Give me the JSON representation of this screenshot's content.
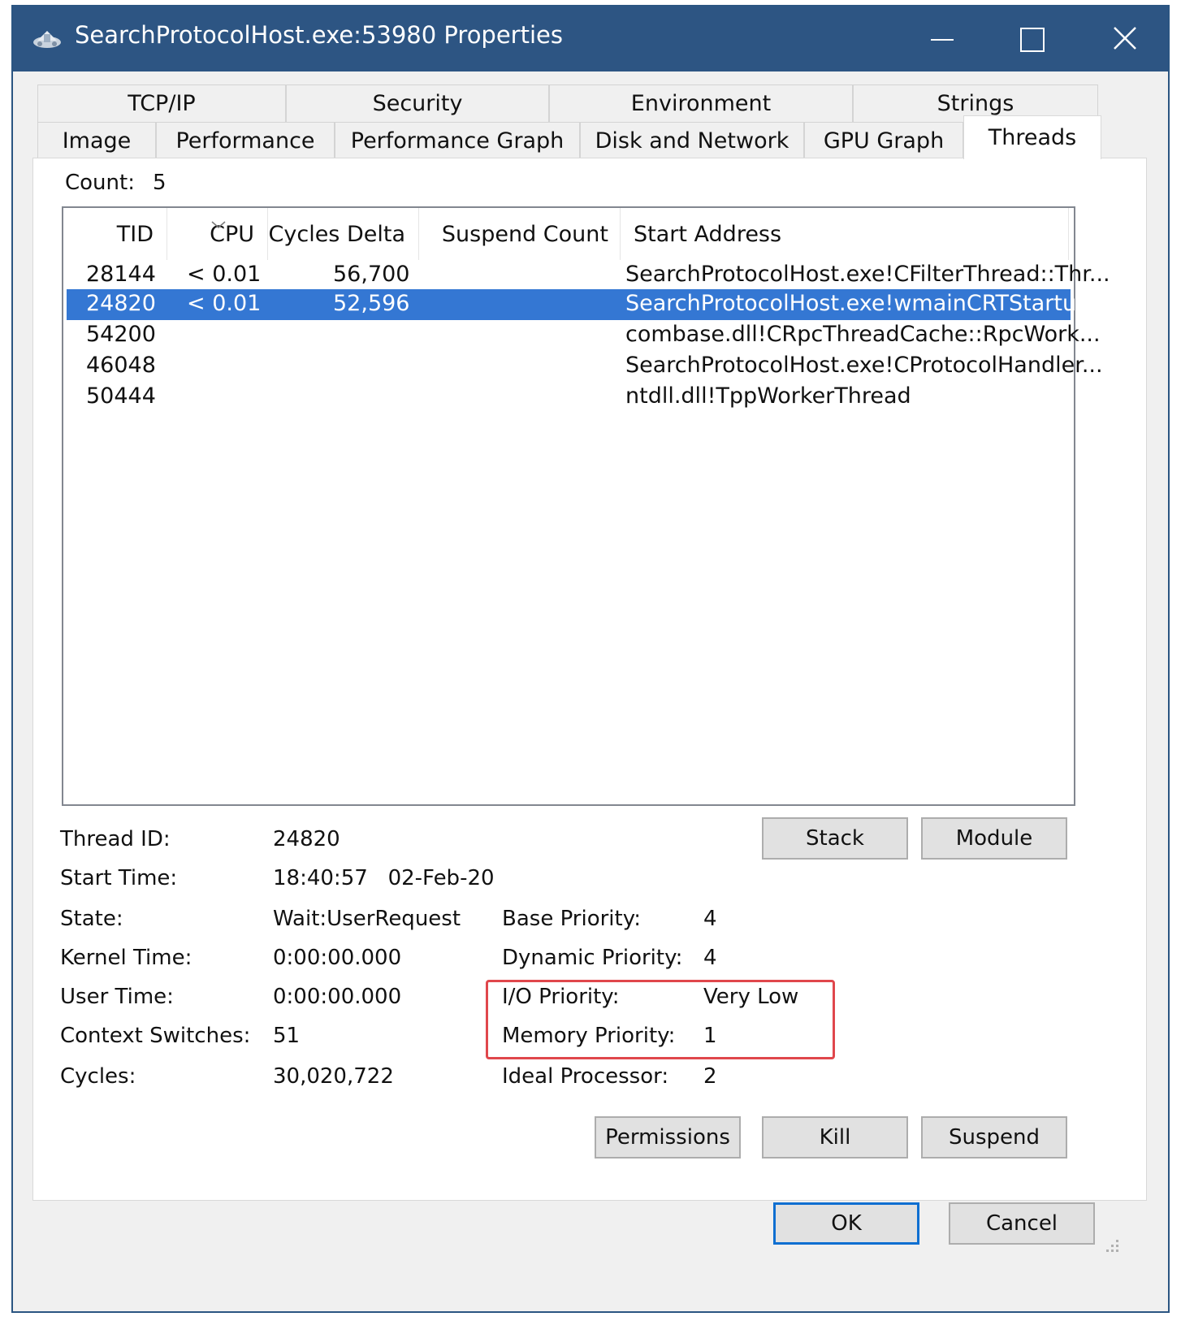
{
  "window": {
    "title": "SearchProtocolHost.exe:53980 Properties"
  },
  "tabs": {
    "row1": [
      {
        "label": "TCP/IP"
      },
      {
        "label": "Security"
      },
      {
        "label": "Environment"
      },
      {
        "label": "Strings"
      }
    ],
    "row2": [
      {
        "label": "Image"
      },
      {
        "label": "Performance"
      },
      {
        "label": "Performance Graph"
      },
      {
        "label": "Disk and Network"
      },
      {
        "label": "GPU Graph"
      },
      {
        "label": "Threads",
        "active": true
      }
    ]
  },
  "threads": {
    "count_label": "Count:",
    "count_value": "5",
    "columns": [
      "TID",
      "CPU",
      "Cycles Delta",
      "Suspend Count",
      "Start Address"
    ],
    "sorted_column": "CPU",
    "rows": [
      {
        "tid": "28144",
        "cpu": "< 0.01",
        "cycles_delta": "56,700",
        "suspend_count": "",
        "start_address": "SearchProtocolHost.exe!CFilterThread::Thr..."
      },
      {
        "tid": "24820",
        "cpu": "< 0.01",
        "cycles_delta": "52,596",
        "suspend_count": "",
        "start_address": "SearchProtocolHost.exe!wmainCRTStartup",
        "selected": true
      },
      {
        "tid": "54200",
        "cpu": "",
        "cycles_delta": "",
        "suspend_count": "",
        "start_address": "combase.dll!CRpcThreadCache::RpcWork..."
      },
      {
        "tid": "46048",
        "cpu": "",
        "cycles_delta": "",
        "suspend_count": "",
        "start_address": "SearchProtocolHost.exe!CProtocolHandler..."
      },
      {
        "tid": "50444",
        "cpu": "",
        "cycles_delta": "",
        "suspend_count": "",
        "start_address": "ntdll.dll!TppWorkerThread"
      }
    ]
  },
  "details": {
    "thread_id": {
      "label": "Thread ID:",
      "value": "24820"
    },
    "start_time": {
      "label": "Start Time:",
      "value": "18:40:57   02-Feb-20"
    },
    "state": {
      "label": "State:",
      "value": "Wait:UserRequest"
    },
    "kernel_time": {
      "label": "Kernel Time:",
      "value": "0:00:00.000"
    },
    "user_time": {
      "label": "User Time:",
      "value": "0:00:00.000"
    },
    "context_switches": {
      "label": "Context Switches:",
      "value": "51"
    },
    "cycles": {
      "label": "Cycles:",
      "value": "30,020,722"
    },
    "base_priority": {
      "label": "Base Priority:",
      "value": "4"
    },
    "dynamic_priority": {
      "label": "Dynamic Priority:",
      "value": "4"
    },
    "io_priority": {
      "label": "I/O Priority:",
      "value": "Very Low"
    },
    "memory_priority": {
      "label": "Memory Priority:",
      "value": "1"
    },
    "ideal_processor": {
      "label": "Ideal Processor:",
      "value": "2"
    }
  },
  "buttons": {
    "stack": "Stack",
    "module": "Module",
    "permissions": "Permissions",
    "kill": "Kill",
    "suspend": "Suspend",
    "ok": "OK",
    "cancel": "Cancel"
  },
  "icons": {
    "app": "process-explorer-icon",
    "minimize": "minimize-icon",
    "maximize": "maximize-icon",
    "close": "close-icon",
    "sort": "sort-descending-icon"
  },
  "colors": {
    "titlebar": "#2d5583",
    "selection": "#3477d3",
    "highlight_box": "#e0474c",
    "default_button_border": "#0f6fd1"
  }
}
